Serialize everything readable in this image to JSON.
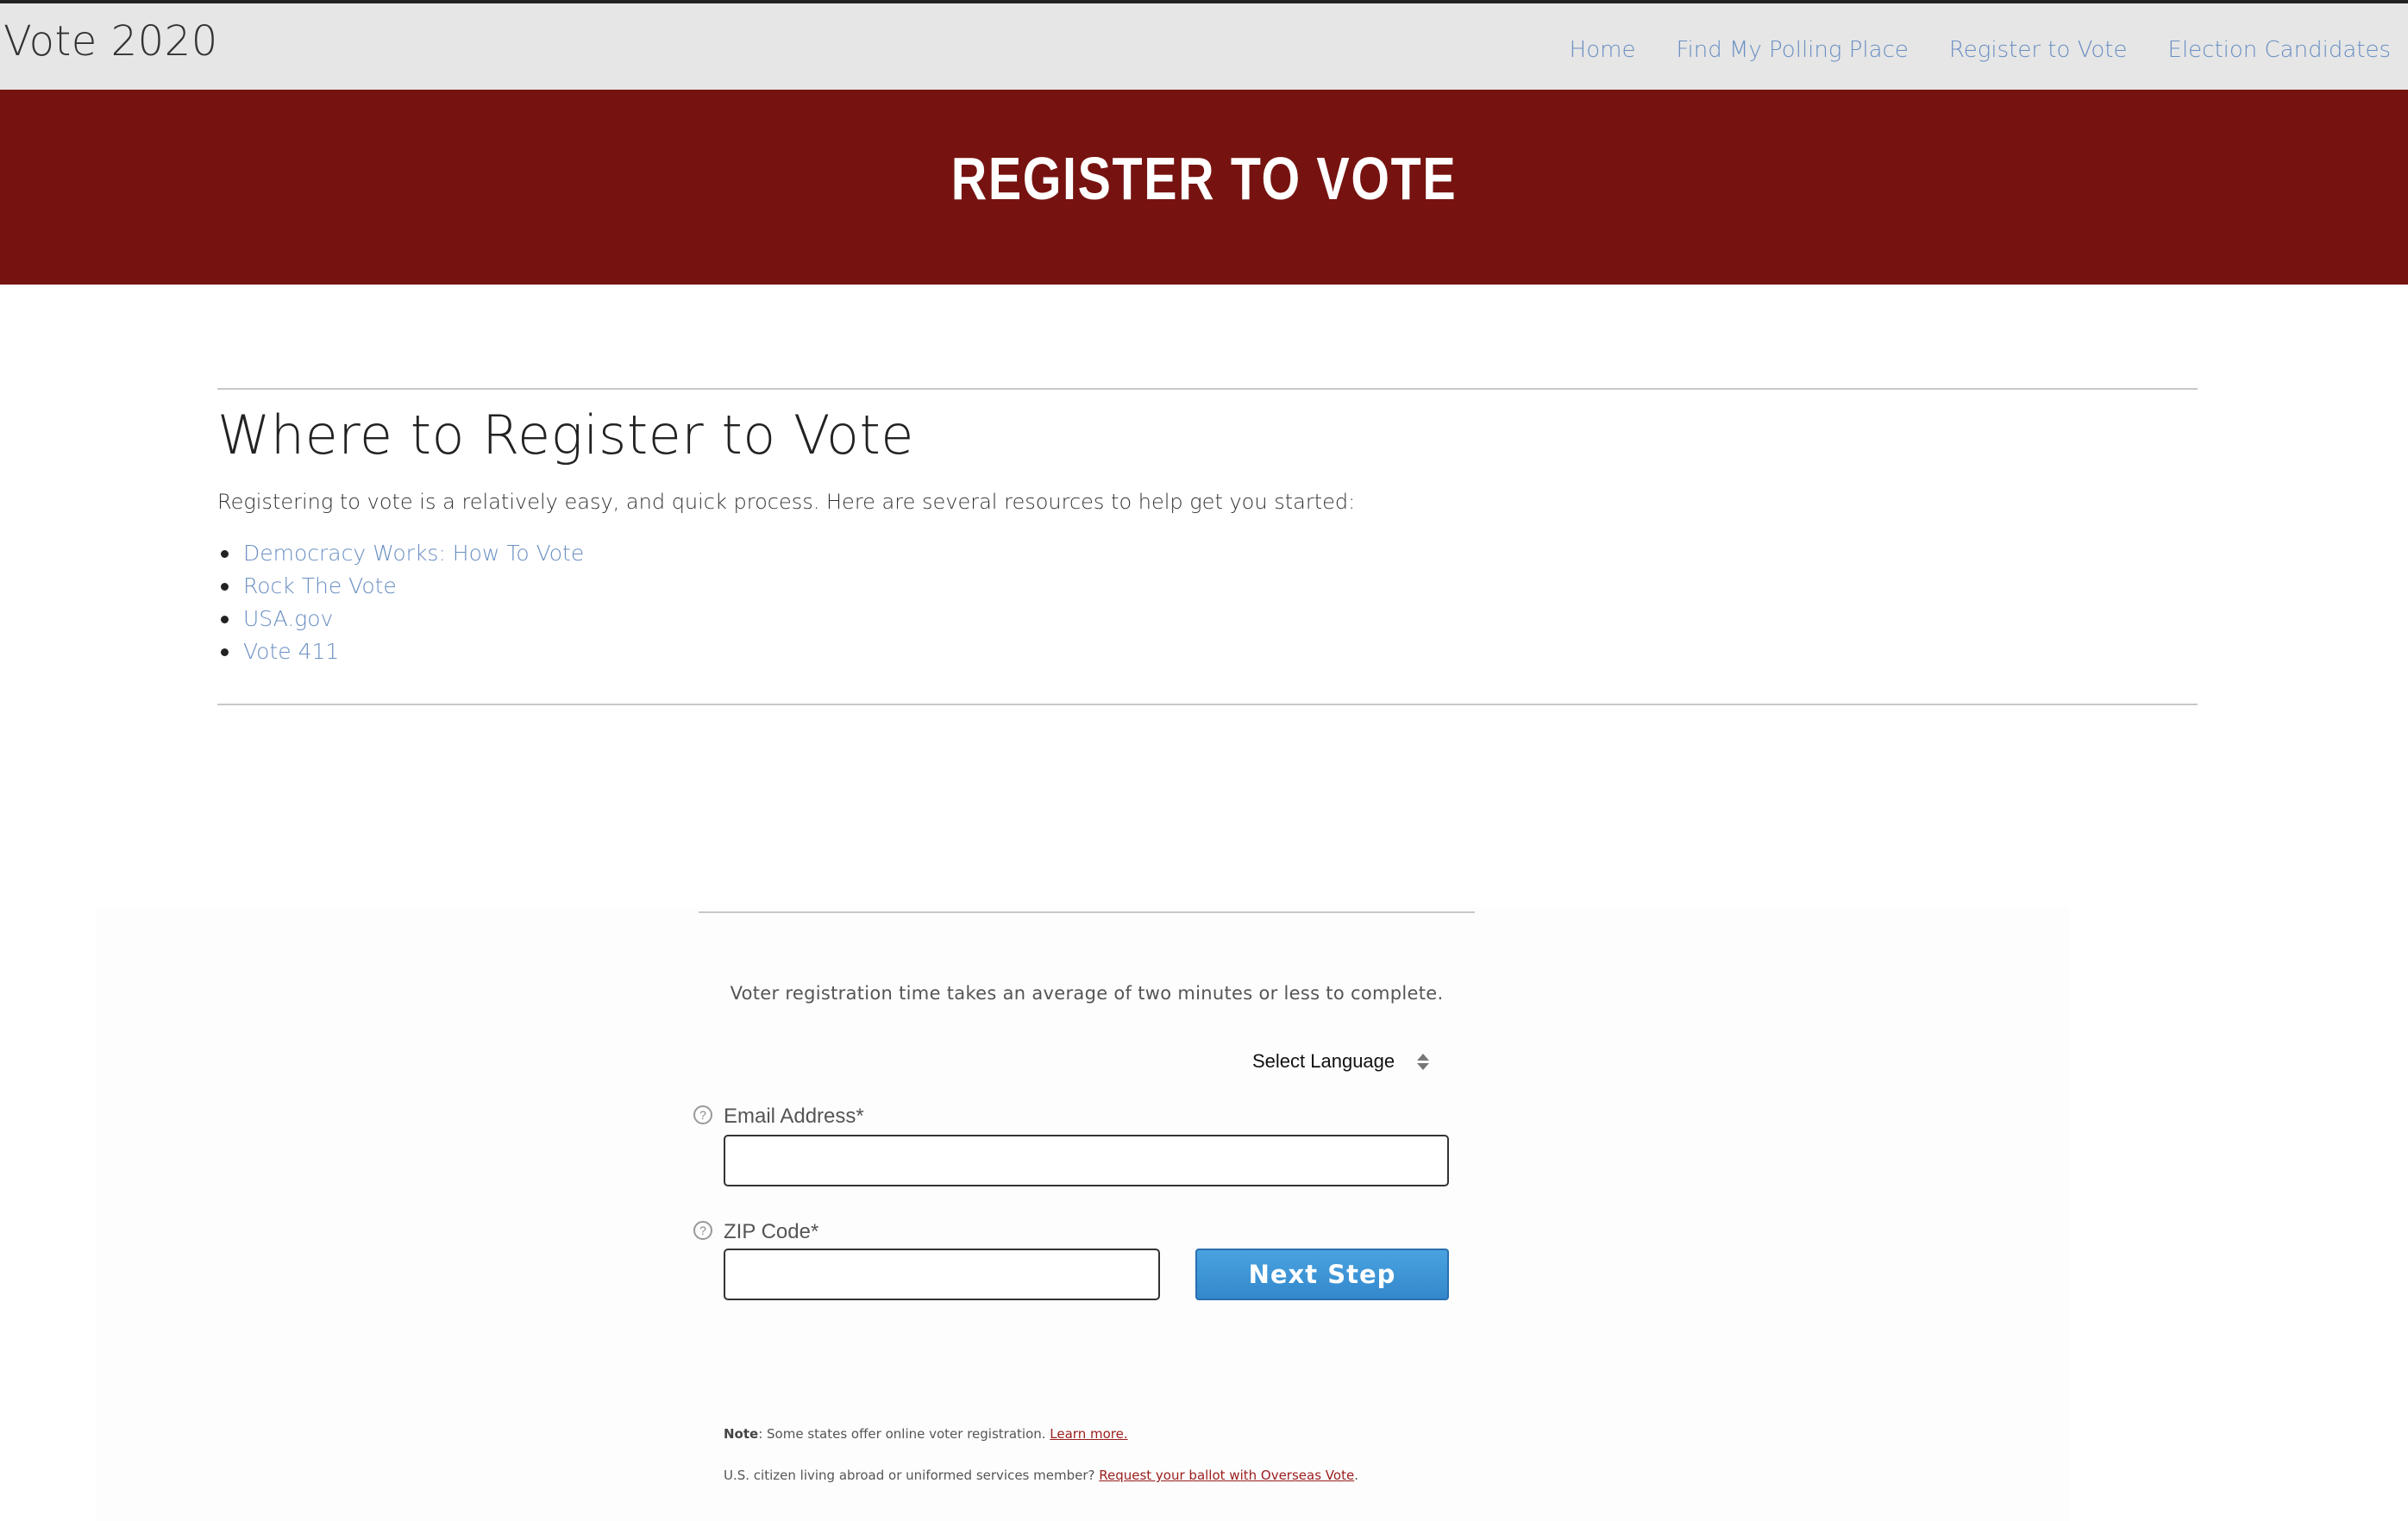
{
  "brand": {
    "title": "Vote 2020"
  },
  "nav": {
    "items": [
      {
        "label": "Home"
      },
      {
        "label": "Find My Polling Place"
      },
      {
        "label": "Register to Vote"
      },
      {
        "label": "Election Candidates"
      }
    ]
  },
  "banner": {
    "title": "REGISTER TO VOTE",
    "background": "#761310"
  },
  "section": {
    "heading": "Where to Register to Vote",
    "intro": "Registering to vote is a relatively easy, and quick process. Here are several resources to help get you started:",
    "links": [
      {
        "label": "Democracy Works: How To Vote"
      },
      {
        "label": "Rock The Vote"
      },
      {
        "label": "USA.gov"
      },
      {
        "label": "Vote 411"
      }
    ]
  },
  "form": {
    "intro": "Voter registration time takes an average of two minutes or less to complete.",
    "language": {
      "label": "Select Language",
      "icon": "select-arrows-icon"
    },
    "email": {
      "label": "Email Address*",
      "value": "",
      "help_icon": "help-icon"
    },
    "zip": {
      "label": "ZIP Code*",
      "value": "",
      "help_icon": "help-icon"
    },
    "submit_label": "Next Step",
    "submit_color": "#3a93d6",
    "note": {
      "prefix": "Note",
      "text": ": Some states offer online voter registration. ",
      "link": "Learn more."
    },
    "overseas": {
      "text": "U.S. citizen living abroad or uniformed services member? ",
      "link": "Request your ballot with Overseas Vote",
      "suffix": "."
    }
  },
  "colors": {
    "nav_bg": "#e6e6e6",
    "link": "#6a8fc2",
    "form_link": "#9a1d1d"
  }
}
